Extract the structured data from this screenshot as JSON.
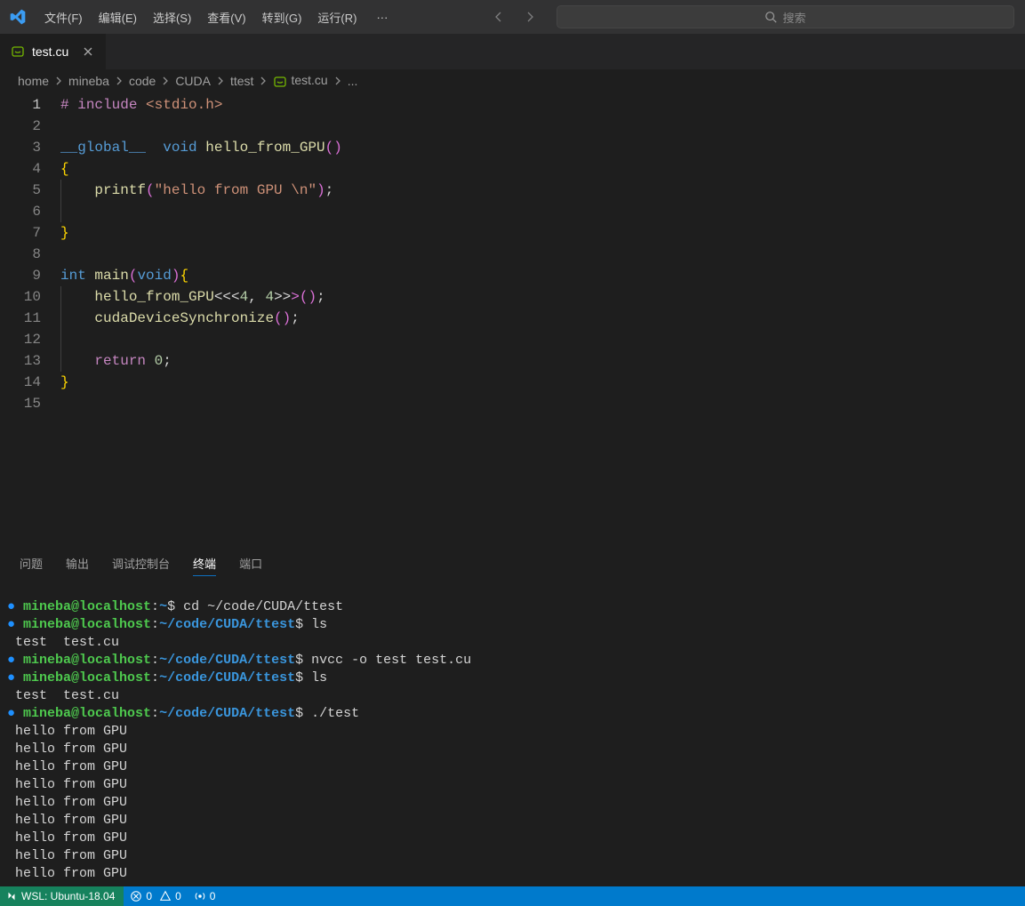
{
  "menu": {
    "file": "文件(F)",
    "edit": "编辑(E)",
    "select": "选择(S)",
    "view": "查看(V)",
    "goto": "转到(G)",
    "run": "运行(R)",
    "more": "···"
  },
  "search": {
    "placeholder": "搜索"
  },
  "tab": {
    "name": "test.cu"
  },
  "breadcrumb": [
    "home",
    "mineba",
    "code",
    "CUDA",
    "ttest",
    "test.cu",
    "..."
  ],
  "code": {
    "lines": [
      {
        "n": 1,
        "html": "<span class='c-pp'>#</span> <span class='c-pp'>include</span> <span class='c-str'>&lt;stdio.h&gt;</span>"
      },
      {
        "n": 2,
        "html": ""
      },
      {
        "n": 3,
        "html": "<span class='c-kw'>__global__</span>  <span class='c-kw'>void</span> <span class='c-fn'>hello_from_GPU</span><span class='c-par'>()</span>"
      },
      {
        "n": 4,
        "html": "<span class='c-cur'>{</span>"
      },
      {
        "n": 5,
        "html": "    <span class='c-fn'>printf</span><span class='c-par'>(</span><span class='c-str'>\"hello from GPU \\n\"</span><span class='c-par'>)</span>;"
      },
      {
        "n": 6,
        "html": "    "
      },
      {
        "n": 7,
        "html": "<span class='c-cur'>}</span>"
      },
      {
        "n": 8,
        "html": ""
      },
      {
        "n": 9,
        "html": "<span class='c-kw'>int</span> <span class='c-fn'>main</span><span class='c-par'>(</span><span class='c-kw'>void</span><span class='c-par'>)</span><span class='c-cur'>{</span>"
      },
      {
        "n": 10,
        "html": "    <span class='c-fn'>hello_from_GPU</span><span class='c-op'>&lt;&lt;&lt;</span><span class='c-num'>4</span>, <span class='c-num'>4</span><span class='c-op'>&gt;&gt;</span><span class='c-par'>&gt;()</span>;"
      },
      {
        "n": 11,
        "html": "    <span class='c-fn'>cudaDeviceSynchronize</span><span class='c-par'>()</span>;"
      },
      {
        "n": 12,
        "html": ""
      },
      {
        "n": 13,
        "html": "    <span class='c-pp'>return</span> <span class='c-num'>0</span>;"
      },
      {
        "n": 14,
        "html": "<span class='c-cur'>}</span>"
      },
      {
        "n": 15,
        "html": ""
      }
    ],
    "active_line": 1
  },
  "panel_tabs": {
    "problems": "问题",
    "output": "输出",
    "debug": "调试控制台",
    "terminal": "终端",
    "ports": "端口"
  },
  "terminal": {
    "prompt": {
      "user": "mineba@localhost",
      "home_path": "~",
      "work_path": "~/code/CUDA/ttest"
    },
    "lines": [
      {
        "type": "prompt",
        "path": "~",
        "cmd": "cd ~/code/CUDA/ttest"
      },
      {
        "type": "prompt",
        "path": "~/code/CUDA/ttest",
        "cmd": "ls"
      },
      {
        "type": "out",
        "text": "test  test.cu"
      },
      {
        "type": "prompt",
        "path": "~/code/CUDA/ttest",
        "cmd": "nvcc -o test test.cu"
      },
      {
        "type": "prompt",
        "path": "~/code/CUDA/ttest",
        "cmd": "ls"
      },
      {
        "type": "out",
        "text": "test  test.cu"
      },
      {
        "type": "prompt",
        "path": "~/code/CUDA/ttest",
        "cmd": "./test"
      },
      {
        "type": "out",
        "text": "hello from GPU"
      },
      {
        "type": "out",
        "text": "hello from GPU"
      },
      {
        "type": "out",
        "text": "hello from GPU"
      },
      {
        "type": "out",
        "text": "hello from GPU"
      },
      {
        "type": "out",
        "text": "hello from GPU"
      },
      {
        "type": "out",
        "text": "hello from GPU"
      },
      {
        "type": "out",
        "text": "hello from GPU"
      },
      {
        "type": "out",
        "text": "hello from GPU"
      },
      {
        "type": "out",
        "text": "hello from GPU"
      }
    ]
  },
  "status": {
    "remote": "WSL: Ubuntu-18.04",
    "errors": "0",
    "warnings": "0",
    "port": "0"
  }
}
